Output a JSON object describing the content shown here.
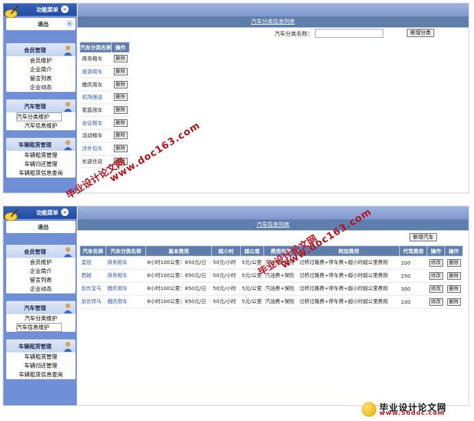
{
  "panel1": {
    "sidebar": {
      "header": "功能菜单",
      "logout": "退出",
      "groups": [
        {
          "title": "会员管理",
          "items": [
            "会员维护",
            "企业简介",
            "留言列表",
            "企业动态"
          ]
        },
        {
          "title": "汽车管理",
          "items": [
            "汽车分类维护",
            "汽车信息维护"
          ]
        },
        {
          "title": "车辆租赁管理",
          "items": [
            "车辆租赁管理",
            "车辆归还管理",
            "车辆租赁信息查询"
          ]
        }
      ]
    },
    "title": "汽车分类信息列表",
    "search_label": "汽车分类名称：",
    "add_button": "新增分类",
    "columns": [
      "汽车分类名称",
      "操作"
    ],
    "rows": [
      "商务租车",
      "旅游用车",
      "婚庆用车",
      "机场接送",
      "家庭用车",
      "会议租车",
      "活动租车",
      "涉外包车",
      "长途往返"
    ],
    "delete_label": "删除"
  },
  "panel2": {
    "sidebar": {
      "header": "功能菜单",
      "logout": "退出",
      "groups": [
        {
          "title": "会员管理",
          "items": [
            "会员维护",
            "企业简介",
            "留言列表",
            "企业动态"
          ]
        },
        {
          "title": "汽车管理",
          "items": [
            "汽车分类维护",
            "汽车信息维护"
          ]
        },
        {
          "title": "车辆租赁管理",
          "items": [
            "车辆租赁管理",
            "车辆归还管理",
            "车辆租赁信息查询"
          ]
        }
      ]
    },
    "title": "汽车信息列表",
    "add_button": "新增汽车",
    "columns": [
      "汽车名称",
      "汽车分类名称",
      "基本费用",
      "超小时",
      "超公里",
      "费用包括",
      "附加费用",
      "代驾费用",
      "操作",
      "操作"
    ],
    "rows": [
      [
        "皇冠",
        "商务租车",
        "8小时100公里：850元/日",
        "50元/小时",
        "5元/公里",
        "汽油费+保险",
        "过桥过路费+停车费+超小时超公里费用",
        "200"
      ],
      [
        "君越",
        "商务租车",
        "8小时100公里：850元/日",
        "50元/小时",
        "5元/公里",
        "汽油费+保险",
        "过桥过路费+停车费+超小时超公里费用",
        "250"
      ],
      [
        "加长宝马",
        "婚庆用车",
        "8小时100公里：850元/日",
        "50元/小时",
        "5元/公里",
        "汽油费+保险",
        "过桥过路费+停车费+超小时超公里费用",
        "300"
      ],
      [
        "加长悍马",
        "婚庆用车",
        "8小时100公里：850元/日",
        "50元/小时",
        "5元/公里",
        "汽油费+保险",
        "过桥过路费+停车费+超小时超公里费用",
        "100"
      ]
    ],
    "edit_label": "修改",
    "delete_label": "删除"
  },
  "watermarks": [
    "毕业设计论文网",
    "www.doc163.com"
  ],
  "brand": {
    "title": "毕业设计论文网",
    "url": "www.56doc.com"
  },
  "colors": {
    "sidebar": "#6f8fd6",
    "header": "#5f7eac",
    "watermark": "#c0141f"
  }
}
